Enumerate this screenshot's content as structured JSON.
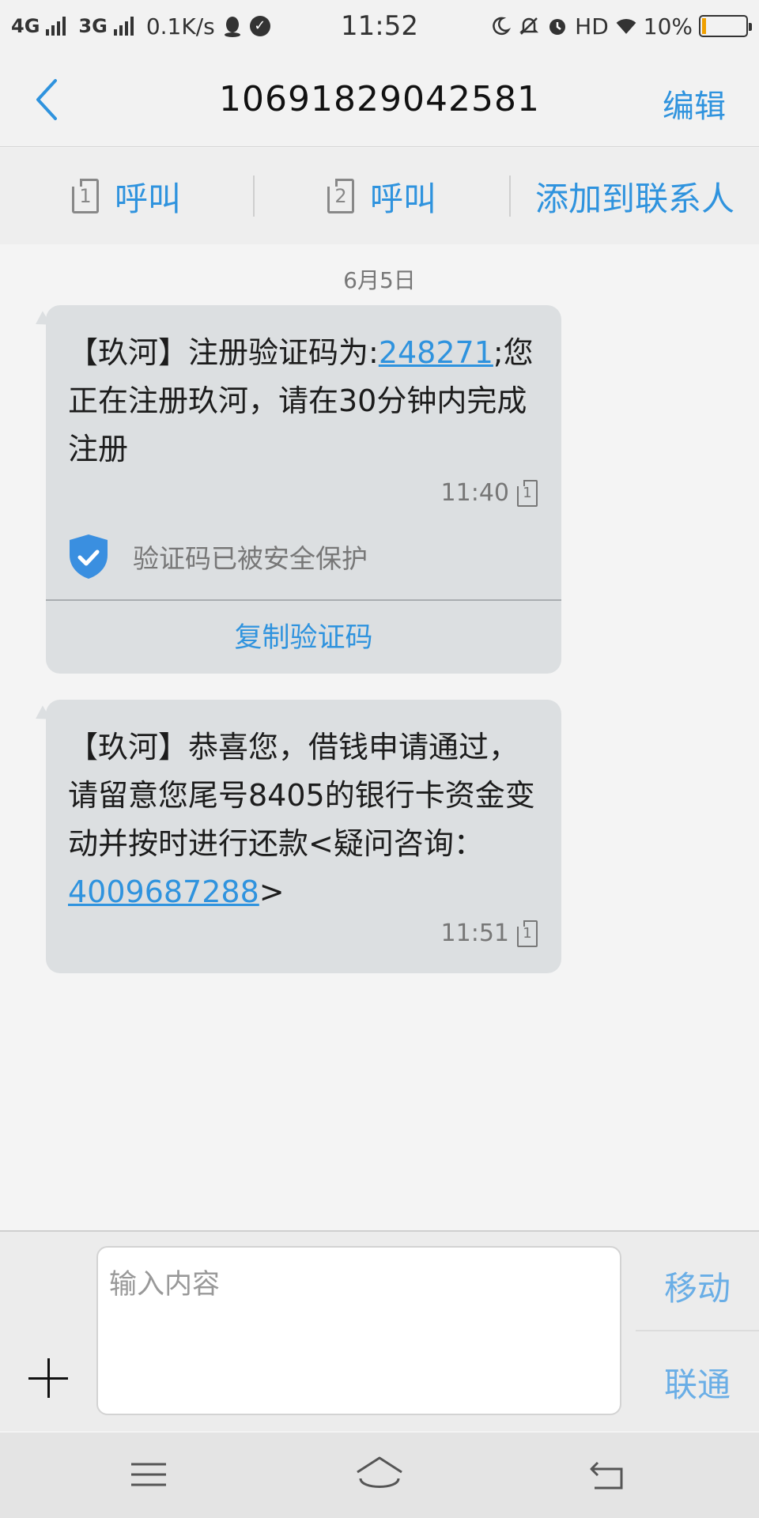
{
  "status_bar": {
    "net1": "4G",
    "net2": "3G",
    "speed": "0.1K/s",
    "time": "11:52",
    "hd": "HD",
    "battery": "10%",
    "battery_level": 0.1
  },
  "header": {
    "title": "10691829042581",
    "edit_label": "编辑"
  },
  "actions": {
    "call1_label": "呼叫",
    "call1_sim": "1",
    "call2_label": "呼叫",
    "call2_sim": "2",
    "add_contact_label": "添加到联系人"
  },
  "conversation": {
    "date": "6月5日",
    "messages": [
      {
        "text_before": "【玖河】注册验证码为:",
        "code": "248271",
        "text_after": ";您正在注册玖河，请在30分钟内完成注册",
        "time": "11:40",
        "sim": "1",
        "protect_text": "验证码已被安全保护",
        "copy_label": "复制验证码"
      },
      {
        "text_before": "【玖河】恭喜您，借钱申请通过，请留意您尾号8405的银行卡资金变动并按时进行还款<疑问咨询：",
        "phone": "4009687288",
        "text_after": ">",
        "time": "11:51",
        "sim": "1"
      }
    ]
  },
  "composer": {
    "placeholder": "输入内容",
    "carrier1": "移动",
    "carrier2": "联通"
  },
  "colors": {
    "accent": "#2f93de",
    "bubble": "#dcdfe1",
    "shield": "#3a8fe0"
  },
  "icons": [
    "back-arrow-icon",
    "sim1-icon",
    "sim2-icon",
    "shield-check-icon",
    "plus-icon",
    "menu-icon",
    "home-icon",
    "back-icon",
    "qq-icon",
    "moon-icon",
    "mute-icon",
    "alarm-icon",
    "wifi-icon",
    "battery-icon"
  ]
}
